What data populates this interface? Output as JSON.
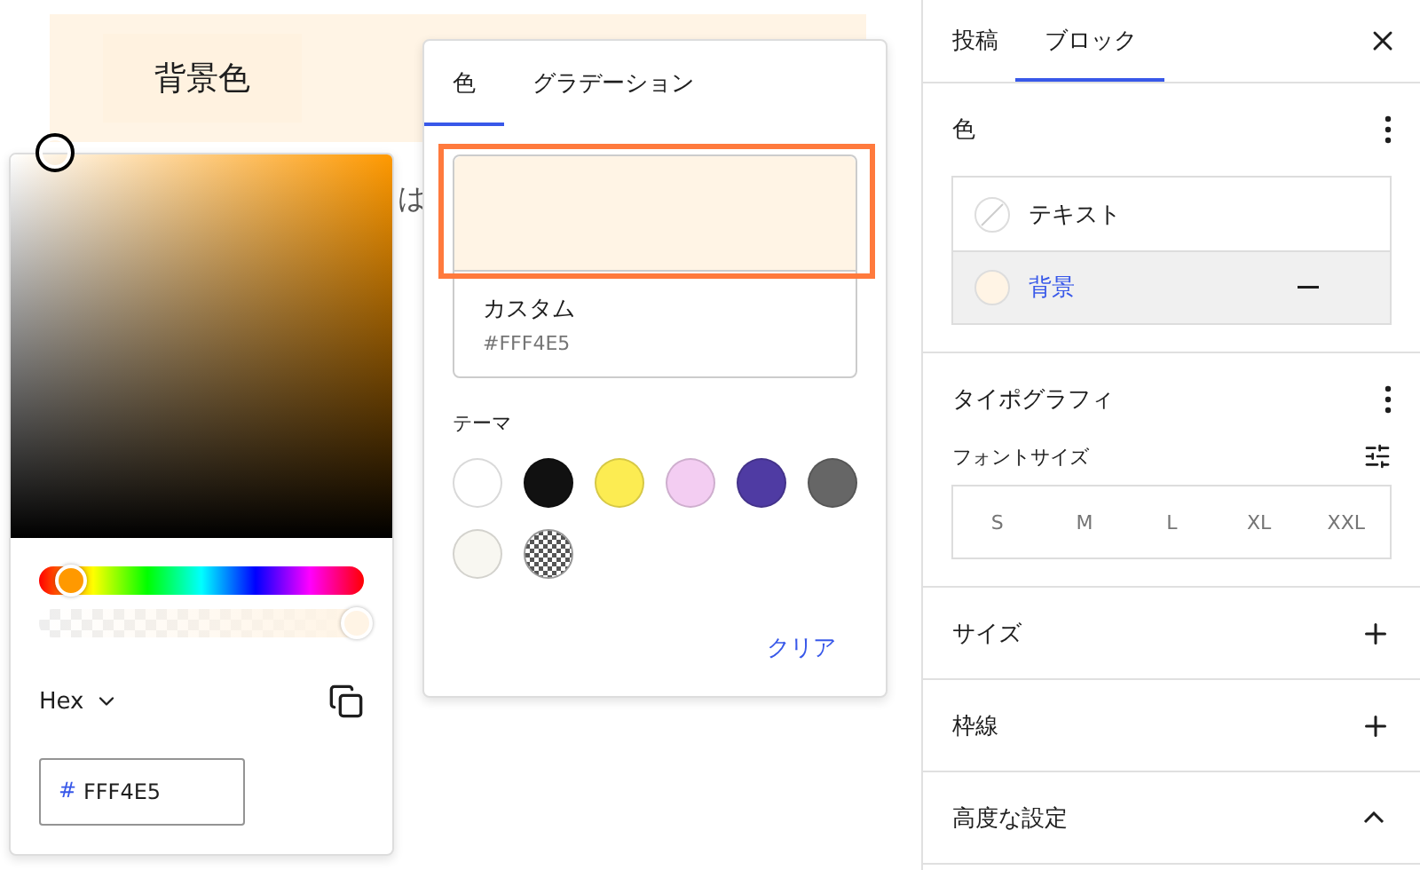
{
  "canvas": {
    "heading": "背景色",
    "paragraph_fragment": "は",
    "color": "#fff4e5"
  },
  "color_picker": {
    "hue": {
      "level": 0.1
    },
    "alpha": {
      "level": 1
    },
    "format": "Hex",
    "hash": "#",
    "value": "FFF4E5"
  },
  "palette": {
    "tabs": [
      {
        "label": "色",
        "selected": true
      },
      {
        "label": "グラデーション",
        "selected": false
      }
    ],
    "custom": {
      "label": "カスタム",
      "value": "#FFF4E5",
      "color": "#fff4e5",
      "highlighted": true
    },
    "theme_label": "テーマ",
    "swatches": [
      {
        "kind": "solid",
        "color": "#ffffff"
      },
      {
        "kind": "solid",
        "color": "#111111"
      },
      {
        "kind": "solid",
        "color": "#fcec52"
      },
      {
        "kind": "solid",
        "color": "#f3cdf2"
      },
      {
        "kind": "solid",
        "color": "#4f3ba3"
      },
      {
        "kind": "solid",
        "color": "#666666"
      },
      {
        "kind": "solid",
        "color": "#f8f7f1"
      },
      {
        "kind": "transparent"
      }
    ],
    "clear": "クリア"
  },
  "sidebar": {
    "tabs": [
      {
        "label": "投稿",
        "selected": false
      },
      {
        "label": "ブロック",
        "selected": true
      }
    ],
    "color_panel": {
      "title": "色",
      "items": [
        {
          "label": "テキスト",
          "kind": "none",
          "selected": false
        },
        {
          "label": "背景",
          "kind": "solid",
          "color": "#fff4e5",
          "selected": true
        }
      ]
    },
    "typography": {
      "title": "タイポグラフィ",
      "font_size_label": "フォントサイズ",
      "sizes": [
        {
          "label": "S",
          "selected": false
        },
        {
          "label": "M",
          "selected": false
        },
        {
          "label": "L",
          "selected": false
        },
        {
          "label": "XL",
          "selected": false
        },
        {
          "label": "XXL",
          "selected": false
        }
      ]
    },
    "panels": [
      {
        "title": "サイズ",
        "expanded": false
      },
      {
        "title": "枠線",
        "expanded": false
      },
      {
        "title": "高度な設定",
        "expanded": true
      }
    ]
  }
}
